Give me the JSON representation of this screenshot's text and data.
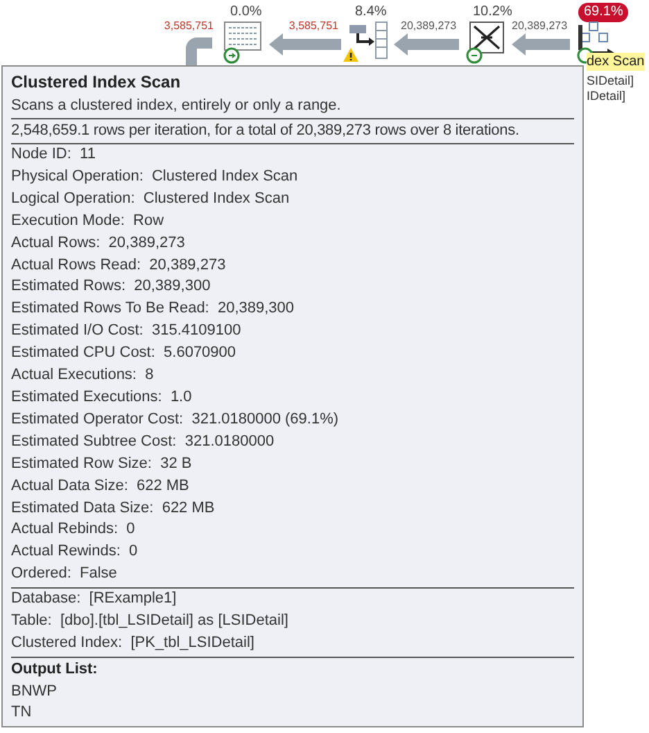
{
  "plan": {
    "nodes": [
      {
        "kind": "bitmap",
        "percent": "0.0%",
        "high_cost": false,
        "warning": false
      },
      {
        "kind": "hash_match",
        "percent": "8.4%",
        "high_cost": false,
        "warning": true
      },
      {
        "kind": "repartition",
        "percent": "10.2%",
        "high_cost": false,
        "warning": false
      },
      {
        "kind": "index_scan",
        "percent": "69.1%",
        "high_cost": true,
        "warning": false,
        "label": "dex Scan",
        "selected": true,
        "details": [
          "SIDetail]",
          "IDetail]"
        ]
      }
    ],
    "edges": [
      {
        "label": "3,585,751",
        "color": "#c0392b"
      },
      {
        "label": "3,585,751",
        "color": "#c0392b"
      },
      {
        "label": "20,389,273",
        "color": "#555555"
      },
      {
        "label": "20,389,273",
        "color": "#555555"
      }
    ]
  },
  "tooltip": {
    "title": "Clustered Index Scan",
    "description": "Scans a clustered index, entirely or only a range.",
    "iterations": "2,548,659.1 rows per iteration, for a total of 20,389,273 rows over 8 iterations.",
    "sections": [
      [
        {
          "label": "Node ID:",
          "value": "11"
        },
        {
          "label": "Physical Operation:",
          "value": "Clustered Index Scan"
        },
        {
          "label": "Logical Operation:",
          "value": "Clustered Index Scan"
        },
        {
          "label": "Execution Mode:",
          "value": "Row"
        },
        {
          "label": "Actual Rows:",
          "value": "20,389,273"
        },
        {
          "label": "Actual Rows Read:",
          "value": "20,389,273"
        },
        {
          "label": "Estimated Rows:",
          "value": "20,389,300"
        },
        {
          "label": "Estimated Rows To Be Read:",
          "value": "20,389,300"
        },
        {
          "label": "Estimated I/O Cost:",
          "value": "315.4109100"
        },
        {
          "label": "Estimated CPU Cost:",
          "value": "5.6070900"
        },
        {
          "label": "Actual Executions:",
          "value": "8"
        },
        {
          "label": "Estimated Executions:",
          "value": "1.0"
        },
        {
          "label": "Estimated Operator Cost:",
          "value": "321.0180000 (69.1%)"
        },
        {
          "label": "Estimated Subtree Cost:",
          "value": "321.0180000"
        },
        {
          "label": "Estimated Row Size:",
          "value": "32 B"
        },
        {
          "label": "Actual Data Size:",
          "value": "622 MB"
        },
        {
          "label": "Estimated Data Size:",
          "value": "622 MB"
        },
        {
          "label": "Actual Rebinds:",
          "value": "0"
        },
        {
          "label": "Actual Rewinds:",
          "value": "0"
        },
        {
          "label": "Ordered:",
          "value": "False"
        }
      ],
      [
        {
          "label": "Database:",
          "value": "[RExample1]"
        },
        {
          "label": "Table:",
          "value": "[dbo].[tbl_LSIDetail] as [LSIDetail]"
        },
        {
          "label": "Clustered Index:",
          "value": "[PK_tbl_LSIDetail]"
        }
      ]
    ],
    "output_list": {
      "title": "Output List:",
      "items": [
        "BNWP",
        "TN"
      ]
    }
  }
}
